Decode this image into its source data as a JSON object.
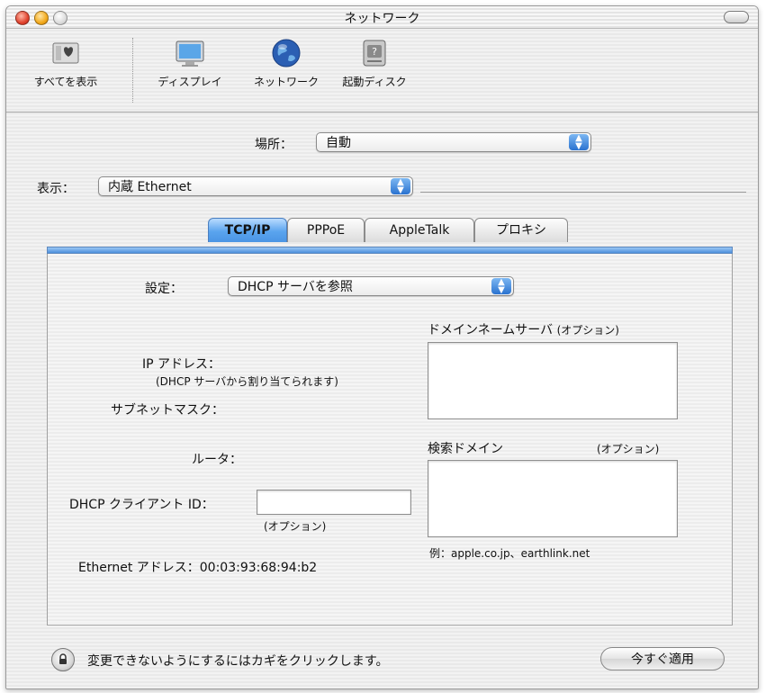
{
  "window": {
    "title": "ネットワーク"
  },
  "toolbar": {
    "items": [
      {
        "label": "すべてを表示",
        "icon": "show-all-icon"
      },
      {
        "label": "ディスプレイ",
        "icon": "display-icon"
      },
      {
        "label": "ネットワーク",
        "icon": "network-globe-icon"
      },
      {
        "label": "起動ディスク",
        "icon": "startup-disk-icon"
      }
    ]
  },
  "location": {
    "label": "場所：",
    "value": "自動"
  },
  "show": {
    "label": "表示：",
    "value": "内蔵 Ethernet"
  },
  "tabs": [
    "TCP/IP",
    "PPPoE",
    "AppleTalk",
    "プロキシ"
  ],
  "selected_tab": "TCP/IP",
  "tcpip": {
    "configure_label": "設定：",
    "configure_value": "DHCP サーバを参照",
    "dns_label": "ドメインネームサーバ",
    "dns_optional": "(オプション)",
    "dns_value": "",
    "ip_label": "IP アドレス：",
    "ip_note": "(DHCP サーバから割り当てられます)",
    "subnet_label": "サブネットマスク：",
    "router_label": "ルータ：",
    "search_label": "検索ドメイン",
    "search_optional": "(オプション)",
    "search_value": "",
    "dhcp_client_label": "DHCP クライアント ID：",
    "dhcp_client_value": "",
    "dhcp_client_optional": "(オプション)",
    "example": "例：apple.co.jp、earthlink.net",
    "ethernet_label": "Ethernet アドレス：",
    "ethernet_value": "00:03:93:68:94:b2"
  },
  "footer": {
    "lock_text": "変更できないようにするにはカギをクリックします。",
    "apply_label": "今すぐ適用"
  },
  "colors": {
    "accent": "#4b95e4",
    "tab_selected": "#5aa4ee"
  }
}
